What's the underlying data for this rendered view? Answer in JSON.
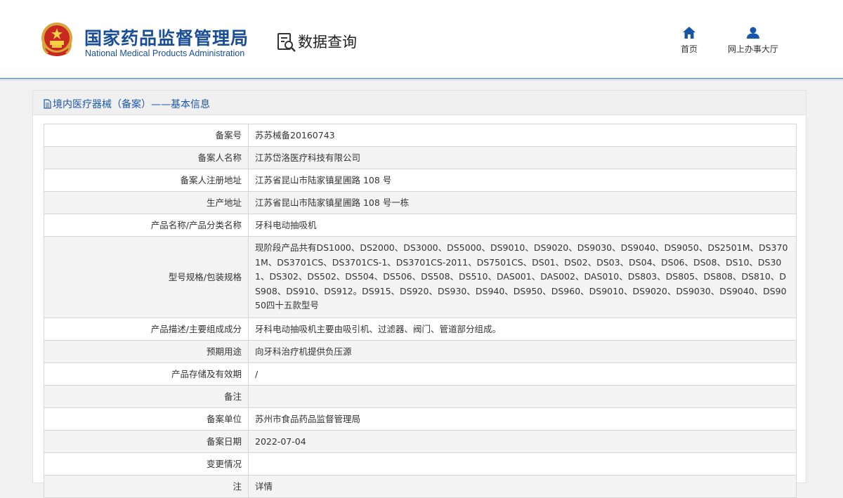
{
  "header": {
    "brand_cn": "国家药品监督管理局",
    "brand_en": "National Medical Products Administration",
    "emblem_icon": "national-emblem-icon",
    "query_title": "数据查询",
    "query_icon": "data-query-icon",
    "nav": [
      {
        "label": "首页",
        "icon": "home-icon"
      },
      {
        "label": "网上办事大厅",
        "icon": "user-icon"
      }
    ]
  },
  "panel": {
    "title": "境内医疗器械（备案）——基本信息",
    "title_icon": "document-icon"
  },
  "rows": [
    {
      "label": "备案号",
      "value": "苏苏械备20160743"
    },
    {
      "label": "备案人名称",
      "value": "江苏岱洛医疗科技有限公司"
    },
    {
      "label": "备案人注册地址",
      "value": "江苏省昆山市陆家镇星圃路 108 号"
    },
    {
      "label": "生产地址",
      "value": "江苏省昆山市陆家镇星圃路 108 号一栋"
    },
    {
      "label": "产品名称/产品分类名称",
      "value": "牙科电动抽吸机"
    },
    {
      "label": "型号规格/包装规格",
      "value": "现阶段产品共有DS1000、DS2000、DS3000、DS5000、DS9010、DS9020、DS9030、DS9040、DS9050、DS2501M、DS3701M、DS3701CS、DS3701CS-1、DS3701CS-2011、DS7501CS、DS01、DS02、DS03、DS04、DS06、DS08、DS10、DS301、DS302、DS502、DS504、DS506、DS508、DS510、DAS001、DAS002、DAS010、DS803、DS805、DS808、DS810、DS908、DS910、DS912。DS915、DS920、DS930、DS940、DS950、DS960、DS9010、DS9020、DS9030、DS9040、DS9050四十五款型号"
    },
    {
      "label": "产品描述/主要组成成分",
      "value": "牙科电动抽吸机主要由吸引机、过滤器、阀门、管道部分组成。"
    },
    {
      "label": "预期用途",
      "value": "向牙科治疗机提供负压源"
    },
    {
      "label": "产品存储及有效期",
      "value": "/"
    },
    {
      "label": "备注",
      "value": ""
    },
    {
      "label": "备案单位",
      "value": "苏州市食品药品监督管理局"
    },
    {
      "label": "备案日期",
      "value": "2022-07-04"
    },
    {
      "label": "变更情况",
      "value": ""
    },
    {
      "label": "注",
      "value": "详情"
    }
  ],
  "colors": {
    "brand": "#1a4f97",
    "link": "#1a56a8",
    "header_border": "#3b79c8"
  }
}
